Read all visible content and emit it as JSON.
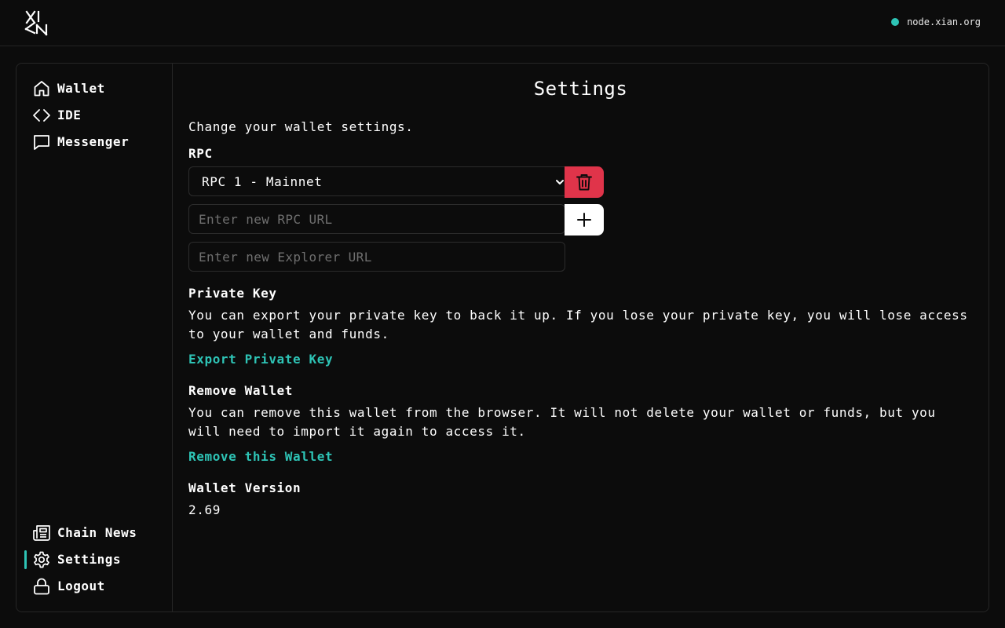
{
  "colors": {
    "accent": "#2ec4b6",
    "danger": "#e0344a",
    "background": "#0c0c0c",
    "border": "#262626"
  },
  "header": {
    "logo_icon": "xian-logo-icon",
    "node": {
      "status": "connected",
      "label": "node.xian.org"
    }
  },
  "sidebar": {
    "top_items": [
      {
        "label": "Wallet",
        "icon": "home-icon"
      },
      {
        "label": "IDE",
        "icon": "code-icon"
      },
      {
        "label": "Messenger",
        "icon": "message-icon"
      }
    ],
    "bottom_items": [
      {
        "label": "Chain News",
        "icon": "newspaper-icon"
      },
      {
        "label": "Settings",
        "icon": "gear-icon",
        "active": true
      },
      {
        "label": "Logout",
        "icon": "lock-icon"
      }
    ]
  },
  "settings": {
    "title": "Settings",
    "intro": "Change your wallet settings.",
    "rpc": {
      "heading": "RPC",
      "selected": "RPC 1 - Mainnet",
      "rpc_url_placeholder": "Enter new RPC URL",
      "explorer_url_placeholder": "Enter new Explorer URL"
    },
    "private_key": {
      "heading": "Private Key",
      "description": "You can export your private key to back it up. If you lose your private key, you will lose access to your wallet and funds.",
      "action": "Export Private Key"
    },
    "remove_wallet": {
      "heading": "Remove Wallet",
      "description": "You can remove this wallet from the browser. It will not delete your wallet or funds, but you will need to import it again to access it.",
      "action": "Remove this Wallet"
    },
    "version": {
      "heading": "Wallet Version",
      "value": "2.69"
    }
  }
}
